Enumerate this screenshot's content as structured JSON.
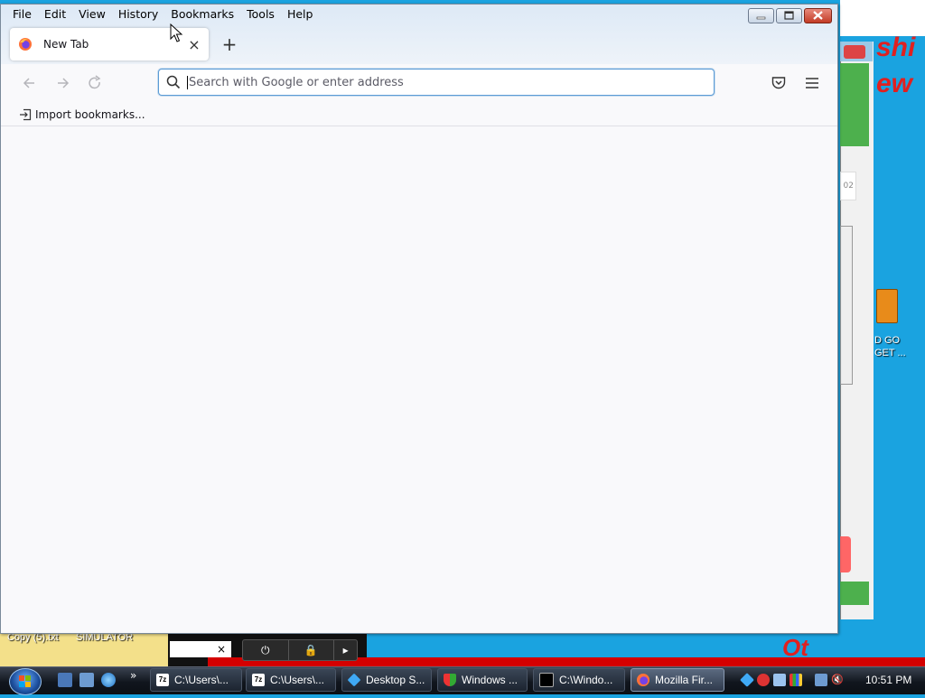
{
  "desktop": {
    "bg_text_1": "shi",
    "bg_text_2": "ew",
    "icon_label": "D GO\nGET ...",
    "field_text": "02",
    "file_label_1": "Copy (5).txt",
    "file_label_2": "SIMULATOR",
    "gadget_close": "×",
    "scribble_text": "Ot"
  },
  "window": {
    "menu": [
      "File",
      "Edit",
      "View",
      "History",
      "Bookmarks",
      "Tools",
      "Help"
    ]
  },
  "tab": {
    "title": "New Tab",
    "close": "×",
    "new_tab": "+"
  },
  "navbar": {
    "url_placeholder": "Search with Google or enter address"
  },
  "bookmarks": {
    "import_label": "Import bookmarks..."
  },
  "taskbar": {
    "overflow": "»",
    "buttons": [
      {
        "label": "C:\\Users\\..."
      },
      {
        "label": "C:\\Users\\..."
      },
      {
        "label": "Desktop S..."
      },
      {
        "label": "Windows ..."
      },
      {
        "label": "C:\\Windo..."
      },
      {
        "label": "Mozilla Fir..."
      }
    ],
    "clock": "10:51 PM"
  },
  "colors": {
    "desktop_blue": "#1aa3e0",
    "accent_focus": "#5b9bd5",
    "firefox_orange": "#ff7139"
  }
}
